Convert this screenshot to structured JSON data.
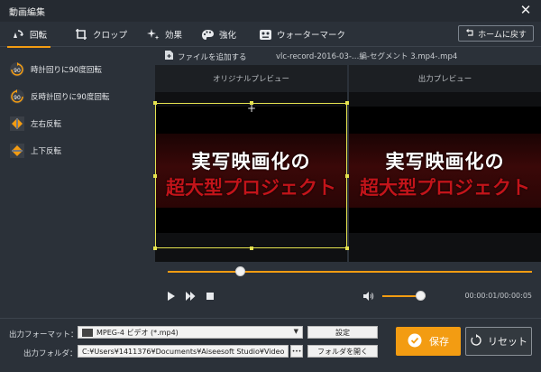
{
  "window": {
    "title": "動画編集"
  },
  "tabs": [
    {
      "label": "回転",
      "icon": "rotate-icon",
      "active": true
    },
    {
      "label": "クロップ",
      "icon": "crop-icon"
    },
    {
      "label": "効果",
      "icon": "sparkle-icon"
    },
    {
      "label": "強化",
      "icon": "palette-icon"
    },
    {
      "label": "ウォーターマーク",
      "icon": "watermark-icon"
    }
  ],
  "home_button": {
    "label": "ホームに戻す"
  },
  "rotate_options": [
    {
      "label": "時計回りに90度回転",
      "icon": "rotate-cw-90-icon"
    },
    {
      "label": "反時計回りに90度回転",
      "icon": "rotate-ccw-90-icon"
    },
    {
      "label": "左右反転",
      "icon": "flip-horizontal-icon"
    },
    {
      "label": "上下反転",
      "icon": "flip-vertical-icon"
    }
  ],
  "file_bar": {
    "add_label": "ファイルを追加する",
    "filename": "vlc-record-2016-03-…編-セグメント 3.mp4-.mp4"
  },
  "preview": {
    "original_label": "オリジナルプレビュー",
    "output_label": "出力プレビュー",
    "caption_line1": "実写映画化の",
    "caption_line2": "超大型プロジェクト"
  },
  "player": {
    "progress": 0.2,
    "volume": 0.9,
    "time": "00:00:01/00:00:05"
  },
  "output": {
    "format_label": "出力フォーマット：",
    "format_value": "MPEG-4 ビデオ (*.mp4)",
    "settings_label": "設定",
    "folder_label": "出力フォルダ：",
    "folder_value": "C:¥Users¥1411376¥Documents¥Aiseesoft Studio¥Video",
    "browse_label": "•••",
    "open_folder_label": "フォルダを開く"
  },
  "actions": {
    "save_label": "保存",
    "reset_label": "リセット"
  },
  "colors": {
    "accent": "#f39c12",
    "background": "#2b3139"
  }
}
